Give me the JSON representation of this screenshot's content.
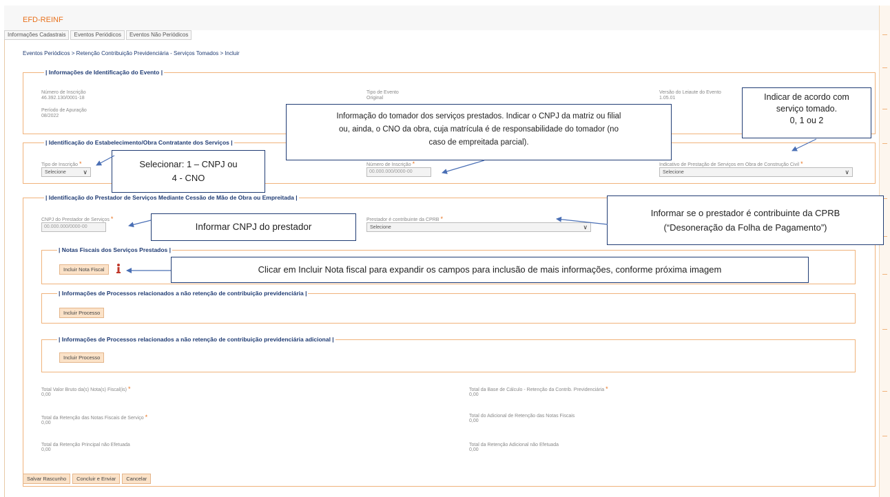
{
  "app": {
    "title": "EFD-REINF"
  },
  "nav": {
    "tabs": [
      "Informações Cadastrais",
      "Eventos Periódicos",
      "Eventos Não Periódicos"
    ]
  },
  "breadcrumb": "Eventos Periódicos > Retenção Contribuição Previdenciária - Serviços Tomados > Incluir",
  "section_event": {
    "legend": "| Informações de Identificação do Evento |",
    "numero_label": "Número de Inscrição",
    "numero_value": "46.392.130/0001-18",
    "periodo_label": "Período de Apuração",
    "periodo_value": "08/2022",
    "tipo_label": "Tipo de Evento",
    "tipo_value": "Original",
    "versao_label": "Versão do Leiaute do Evento",
    "versao_value": "1.05.01"
  },
  "section_estab": {
    "legend": "| Identificação do Estabelecimento/Obra Contratante dos Serviços |",
    "tipo_label": "Tipo de Inscrição",
    "tipo_value": "Selecione",
    "numero_label": "Número de Inscrição",
    "numero_placeholder": "00.000.000/0000-00",
    "indicativo_label": "Indicativo de Prestação de Serviços em Obra de Construção Civil",
    "indicativo_value": "Selecione"
  },
  "section_prestador": {
    "legend": "| Identificação do Prestador de Serviços Mediante Cessão de Mão de Obra ou Empreitada |",
    "cnpj_label": "CNPJ do Prestador de Serviços",
    "cnpj_placeholder": "00.000.000/0000-00",
    "cprb_label": "Prestador é contribuinte da CPRB",
    "cprb_value": "Selecione",
    "notas_legend": "| Notas Fiscais dos Serviços Prestados |",
    "incluir_nota_label": "Incluir Nota Fiscal",
    "processos_legend": "| Informações de Processos relacionados a não retenção de contribuição previdenciária |",
    "processos_adic_legend": "| Informações de Processos relacionados a não retenção de contribuição previdenciária adicional |",
    "incluir_processo_label": "Incluir Processo",
    "incluir_processo_adic_label": "Incluir Processo"
  },
  "totals": [
    {
      "label": "Total Valor Bruto da(s) Nota(s) Fiscal(is)",
      "value": "0,00",
      "required": true
    },
    {
      "label": "Total da Base de Cálculo - Retenção da Contrib. Previdenciária",
      "value": "0,00",
      "required": true
    },
    {
      "label": "Total da Retenção das Notas Fiscais de Serviço",
      "value": "0,00",
      "required": true
    },
    {
      "label": "Total do Adicional de Retenção das Notas Fiscais",
      "value": "0,00",
      "required": false
    },
    {
      "label": "Total da Retenção Principal não Efetuada",
      "value": "0,00",
      "required": false
    },
    {
      "label": "Total da Retenção Adicional não Efetuada",
      "value": "0,00",
      "required": false
    }
  ],
  "actions": {
    "save": "Salvar Rascunho",
    "send": "Concluir e Enviar",
    "cancel": "Cancelar"
  },
  "required_mark": "*",
  "callouts": {
    "indicar": [
      "Indicar de acordo com",
      "serviço tomado.",
      "0, 1 ou 2"
    ],
    "tomador": [
      "Informação do tomador dos serviços prestados. Indicar o CNPJ da matriz ou filial",
      "ou, ainda, o CNO da obra, cuja matrícula é de responsabilidade do tomador (no",
      "caso de empreitada parcial)."
    ],
    "selecionar": [
      "Selecionar: 1 – CNPJ ou",
      "4 - CNO"
    ],
    "cprb": [
      "Informar se o prestador é contribuinte da CPRB",
      "(“Desoneração da Folha de Pagamento”)"
    ],
    "cnpj_prestador": "Informar CNPJ do prestador",
    "incluir_nota": "Clicar em Incluir Nota fiscal para expandir os campos para inclusão de mais informações, conforme próxima imagem"
  },
  "colors": {
    "accent": "#e8711c",
    "border": "#f0b27a",
    "link": "#1f3b73",
    "callout_arrow": "#4a6fb5"
  },
  "icons": {
    "info": "info-icon",
    "chevron": "chevron-down-icon"
  }
}
